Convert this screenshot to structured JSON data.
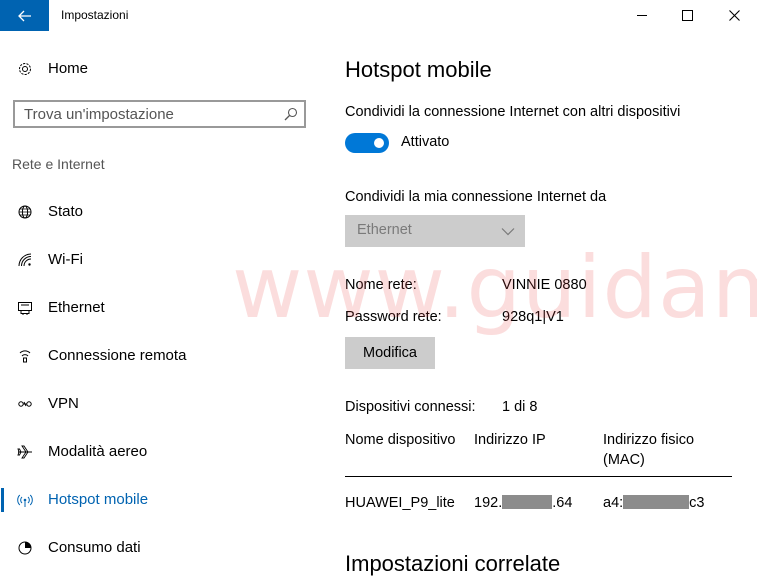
{
  "window": {
    "title": "Impostazioni",
    "back_icon": "arrow-left-icon",
    "minimize_icon": "minimize-icon",
    "maximize_icon": "maximize-icon",
    "close_icon": "close-icon",
    "accent_color": "#0063b1"
  },
  "sidebar": {
    "home": {
      "icon": "gear-icon",
      "label": "Home"
    },
    "search": {
      "placeholder": "Trova un'impostazione",
      "icon": "search-icon"
    },
    "section_label": "Rete e Internet",
    "items": [
      {
        "icon": "globe-icon",
        "label": "Stato",
        "active": false
      },
      {
        "icon": "wifi-icon",
        "label": "Wi-Fi",
        "active": false
      },
      {
        "icon": "ethernet-icon",
        "label": "Ethernet",
        "active": false
      },
      {
        "icon": "dialup-icon",
        "label": "Connessione remota",
        "active": false
      },
      {
        "icon": "vpn-icon",
        "label": "VPN",
        "active": false
      },
      {
        "icon": "airplane-icon",
        "label": "Modalità aereo",
        "active": false
      },
      {
        "icon": "hotspot-icon",
        "label": "Hotspot mobile",
        "active": true
      },
      {
        "icon": "data-usage-icon",
        "label": "Consumo dati",
        "active": false
      }
    ]
  },
  "main": {
    "title": "Hotspot mobile",
    "share_label": "Condividi la connessione Internet con altri dispositivi",
    "toggle": {
      "on": true,
      "label": "Attivato"
    },
    "share_from_label": "Condividi la mia connessione Internet da",
    "share_from_value": "Ethernet",
    "network_name_label": "Nome rete:",
    "network_name_value": "VINNIE 0880",
    "password_label": "Password rete:",
    "password_value": "928q1|V1",
    "edit_button": "Modifica",
    "connected_label": "Dispositivi connessi:",
    "connected_value": "1 di 8",
    "table": {
      "headers": [
        "Nome dispositivo",
        "Indirizzo IP",
        "Indirizzo fisico (MAC)"
      ],
      "rows": [
        {
          "name": "HUAWEI_P9_lite",
          "ip_prefix": "192.",
          "ip_suffix": ".64",
          "mac_prefix": "a4:",
          "mac_suffix": "c3"
        }
      ]
    },
    "related_title": "Impostazioni correlate"
  },
  "watermark": "www.guidami.info"
}
